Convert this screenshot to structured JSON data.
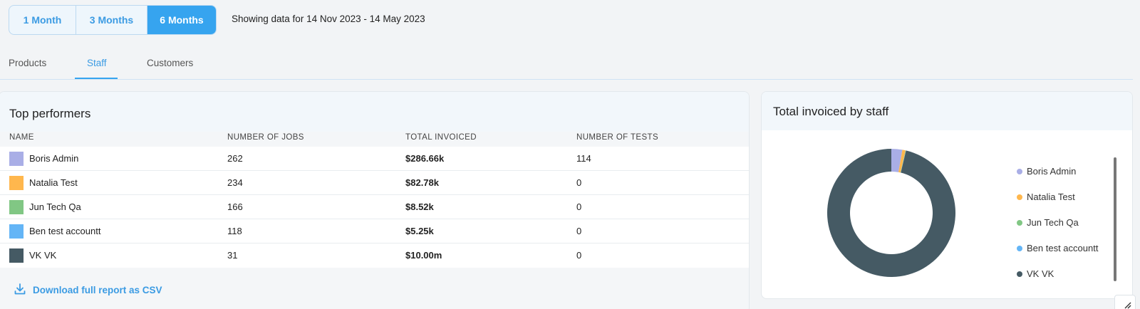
{
  "period": {
    "options": [
      "1 Month",
      "3 Months",
      "6 Months"
    ],
    "active": "6 Months",
    "showing_text": "Showing data for 14 Nov 2023 - 14 May 2023"
  },
  "tabs": [
    {
      "label": "Products",
      "active": false
    },
    {
      "label": "Staff",
      "active": true
    },
    {
      "label": "Customers",
      "active": false
    }
  ],
  "top_performers": {
    "title": "Top performers",
    "columns": [
      "NAME",
      "NUMBER OF JOBS",
      "TOTAL INVOICED",
      "NUMBER OF TESTS"
    ],
    "rows": [
      {
        "name": "Boris Admin",
        "jobs": "262",
        "invoiced": "$286.66k",
        "tests": "114",
        "color": "#a9aee6"
      },
      {
        "name": "Natalia Test",
        "jobs": "234",
        "invoiced": "$82.78k",
        "tests": "0",
        "color": "#ffb74d"
      },
      {
        "name": "Jun Tech Qa",
        "jobs": "166",
        "invoiced": "$8.52k",
        "tests": "0",
        "color": "#81c784"
      },
      {
        "name": "Ben test accountt",
        "jobs": "118",
        "invoiced": "$5.25k",
        "tests": "0",
        "color": "#64b5f6"
      },
      {
        "name": "VK VK",
        "jobs": "31",
        "invoiced": "$10.00m",
        "tests": "0",
        "color": "#455a64"
      }
    ],
    "download_label": "Download full report as CSV"
  },
  "staff_chart": {
    "title": "Total invoiced by staff"
  },
  "chart_data": {
    "type": "pie",
    "title": "Total invoiced by staff",
    "donut": true,
    "legend_position": "right",
    "categories": [
      "Boris Admin",
      "Natalia Test",
      "Jun Tech Qa",
      "Ben test accountt",
      "VK VK"
    ],
    "values": [
      286660,
      82780,
      8520,
      5250,
      10000000
    ],
    "colors": [
      "#a9aee6",
      "#ffb74d",
      "#81c784",
      "#64b5f6",
      "#455a64"
    ]
  }
}
